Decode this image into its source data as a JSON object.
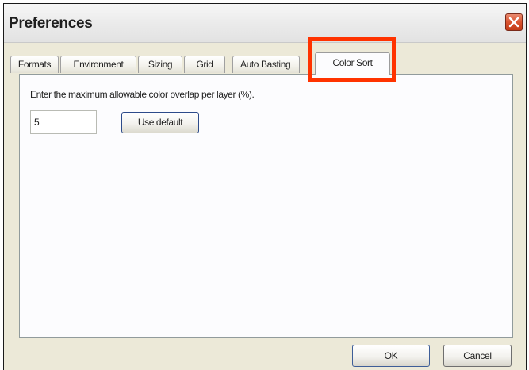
{
  "window": {
    "title": "Preferences"
  },
  "icons": {
    "close": "close-icon"
  },
  "colors": {
    "highlight": "#ff3300",
    "close_button": "#d9532f"
  },
  "tabs": [
    {
      "label": "Formats"
    },
    {
      "label": "Environment"
    },
    {
      "label": "Sizing"
    },
    {
      "label": "Grid"
    },
    {
      "label": "Auto Basting"
    },
    {
      "label": "Color Sort",
      "active": true
    }
  ],
  "color_sort": {
    "instruction": "Enter the maximum allowable color overlap per layer (%).",
    "overlap_value": "5",
    "use_default_label": "Use default"
  },
  "footer": {
    "ok_label": "OK",
    "cancel_label": "Cancel"
  }
}
